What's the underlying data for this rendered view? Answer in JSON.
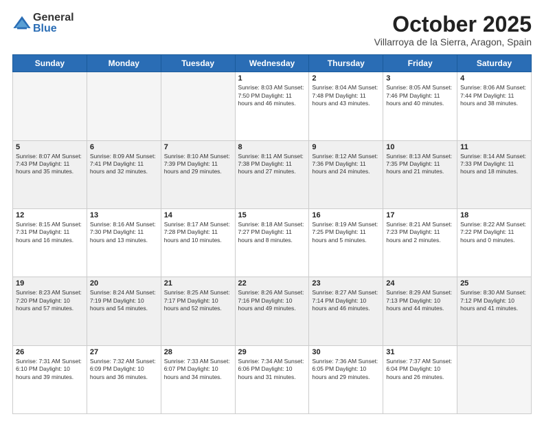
{
  "logo": {
    "general": "General",
    "blue": "Blue"
  },
  "header": {
    "month": "October 2025",
    "location": "Villarroya de la Sierra, Aragon, Spain"
  },
  "weekdays": [
    "Sunday",
    "Monday",
    "Tuesday",
    "Wednesday",
    "Thursday",
    "Friday",
    "Saturday"
  ],
  "weeks": [
    [
      {
        "day": "",
        "text": "",
        "empty": true
      },
      {
        "day": "",
        "text": "",
        "empty": true
      },
      {
        "day": "",
        "text": "",
        "empty": true
      },
      {
        "day": "1",
        "text": "Sunrise: 8:03 AM\nSunset: 7:50 PM\nDaylight: 11 hours\nand 46 minutes."
      },
      {
        "day": "2",
        "text": "Sunrise: 8:04 AM\nSunset: 7:48 PM\nDaylight: 11 hours\nand 43 minutes."
      },
      {
        "day": "3",
        "text": "Sunrise: 8:05 AM\nSunset: 7:46 PM\nDaylight: 11 hours\nand 40 minutes."
      },
      {
        "day": "4",
        "text": "Sunrise: 8:06 AM\nSunset: 7:44 PM\nDaylight: 11 hours\nand 38 minutes."
      }
    ],
    [
      {
        "day": "5",
        "text": "Sunrise: 8:07 AM\nSunset: 7:43 PM\nDaylight: 11 hours\nand 35 minutes."
      },
      {
        "day": "6",
        "text": "Sunrise: 8:09 AM\nSunset: 7:41 PM\nDaylight: 11 hours\nand 32 minutes."
      },
      {
        "day": "7",
        "text": "Sunrise: 8:10 AM\nSunset: 7:39 PM\nDaylight: 11 hours\nand 29 minutes."
      },
      {
        "day": "8",
        "text": "Sunrise: 8:11 AM\nSunset: 7:38 PM\nDaylight: 11 hours\nand 27 minutes."
      },
      {
        "day": "9",
        "text": "Sunrise: 8:12 AM\nSunset: 7:36 PM\nDaylight: 11 hours\nand 24 minutes."
      },
      {
        "day": "10",
        "text": "Sunrise: 8:13 AM\nSunset: 7:35 PM\nDaylight: 11 hours\nand 21 minutes."
      },
      {
        "day": "11",
        "text": "Sunrise: 8:14 AM\nSunset: 7:33 PM\nDaylight: 11 hours\nand 18 minutes."
      }
    ],
    [
      {
        "day": "12",
        "text": "Sunrise: 8:15 AM\nSunset: 7:31 PM\nDaylight: 11 hours\nand 16 minutes."
      },
      {
        "day": "13",
        "text": "Sunrise: 8:16 AM\nSunset: 7:30 PM\nDaylight: 11 hours\nand 13 minutes."
      },
      {
        "day": "14",
        "text": "Sunrise: 8:17 AM\nSunset: 7:28 PM\nDaylight: 11 hours\nand 10 minutes."
      },
      {
        "day": "15",
        "text": "Sunrise: 8:18 AM\nSunset: 7:27 PM\nDaylight: 11 hours\nand 8 minutes."
      },
      {
        "day": "16",
        "text": "Sunrise: 8:19 AM\nSunset: 7:25 PM\nDaylight: 11 hours\nand 5 minutes."
      },
      {
        "day": "17",
        "text": "Sunrise: 8:21 AM\nSunset: 7:23 PM\nDaylight: 11 hours\nand 2 minutes."
      },
      {
        "day": "18",
        "text": "Sunrise: 8:22 AM\nSunset: 7:22 PM\nDaylight: 11 hours\nand 0 minutes."
      }
    ],
    [
      {
        "day": "19",
        "text": "Sunrise: 8:23 AM\nSunset: 7:20 PM\nDaylight: 10 hours\nand 57 minutes."
      },
      {
        "day": "20",
        "text": "Sunrise: 8:24 AM\nSunset: 7:19 PM\nDaylight: 10 hours\nand 54 minutes."
      },
      {
        "day": "21",
        "text": "Sunrise: 8:25 AM\nSunset: 7:17 PM\nDaylight: 10 hours\nand 52 minutes."
      },
      {
        "day": "22",
        "text": "Sunrise: 8:26 AM\nSunset: 7:16 PM\nDaylight: 10 hours\nand 49 minutes."
      },
      {
        "day": "23",
        "text": "Sunrise: 8:27 AM\nSunset: 7:14 PM\nDaylight: 10 hours\nand 46 minutes."
      },
      {
        "day": "24",
        "text": "Sunrise: 8:29 AM\nSunset: 7:13 PM\nDaylight: 10 hours\nand 44 minutes."
      },
      {
        "day": "25",
        "text": "Sunrise: 8:30 AM\nSunset: 7:12 PM\nDaylight: 10 hours\nand 41 minutes."
      }
    ],
    [
      {
        "day": "26",
        "text": "Sunrise: 7:31 AM\nSunset: 6:10 PM\nDaylight: 10 hours\nand 39 minutes."
      },
      {
        "day": "27",
        "text": "Sunrise: 7:32 AM\nSunset: 6:09 PM\nDaylight: 10 hours\nand 36 minutes."
      },
      {
        "day": "28",
        "text": "Sunrise: 7:33 AM\nSunset: 6:07 PM\nDaylight: 10 hours\nand 34 minutes."
      },
      {
        "day": "29",
        "text": "Sunrise: 7:34 AM\nSunset: 6:06 PM\nDaylight: 10 hours\nand 31 minutes."
      },
      {
        "day": "30",
        "text": "Sunrise: 7:36 AM\nSunset: 6:05 PM\nDaylight: 10 hours\nand 29 minutes."
      },
      {
        "day": "31",
        "text": "Sunrise: 7:37 AM\nSunset: 6:04 PM\nDaylight: 10 hours\nand 26 minutes."
      },
      {
        "day": "",
        "text": "",
        "empty": true
      }
    ]
  ]
}
